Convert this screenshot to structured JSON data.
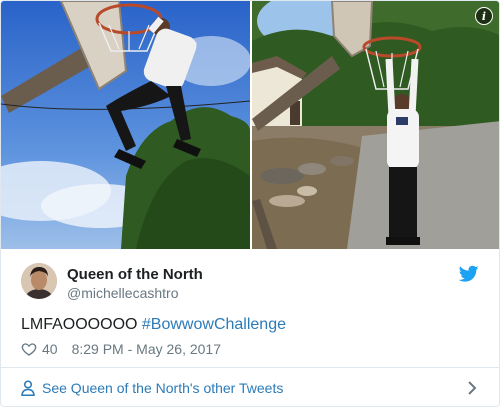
{
  "author": {
    "name": "Queen of the North",
    "handle": "@michellecashtro"
  },
  "tweet": {
    "text_plain": "LMFAOOOOOO ",
    "hashtag": "#BowwowChallenge",
    "likes": "40",
    "timestamp": "8:29 PM - May 26, 2017"
  },
  "footer": {
    "link_label": "See Queen of the North's other Tweets"
  },
  "icons": {
    "info": "info-icon",
    "twitter": "twitter-bird-icon",
    "like": "heart-icon",
    "profile": "person-icon",
    "chevron": "chevron-right-icon"
  },
  "colors": {
    "link": "#2b7bb9",
    "secondary_text": "#697882",
    "primary_text": "#1c2022",
    "twitter_blue": "#1da1f2",
    "border": "#e1e8ed"
  }
}
